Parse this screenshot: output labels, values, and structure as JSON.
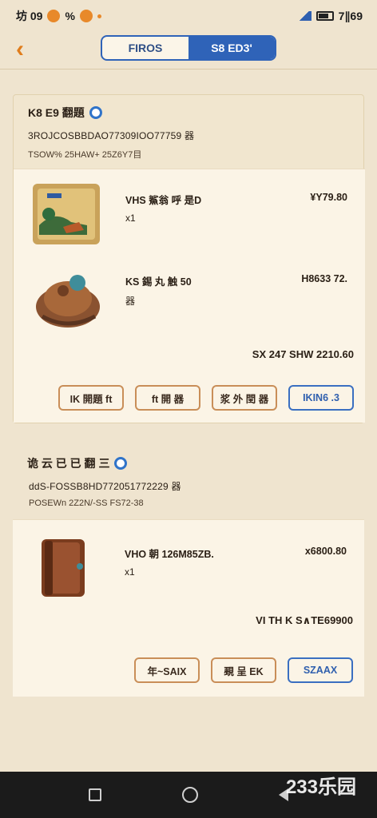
{
  "status_bar": {
    "time": "坊 09",
    "mid": "%",
    "right_text": "7∥69"
  },
  "header": {
    "tabs": [
      "FIROS",
      "S8 ED3'"
    ]
  },
  "orders": [
    {
      "shop_name": "K8 E9 翻題",
      "order_id": "3ROJCOSBBDAO77309IOO77759 器",
      "order_time": "TSOW% 25HAW+ 25Z6Y7目",
      "items": [
        {
          "title": "VHS 鯊翁 呼 是D",
          "qty": "x1",
          "price": "¥Y79.80"
        },
        {
          "title": "KS 錫 丸 触 50",
          "qty": "器",
          "price": "H8633 72."
        }
      ],
      "total": "SX 247 SHW 2210.60",
      "buttons": [
        "IK 開題 ft",
        "ft 開 器",
        "浆 外 閏 器",
        "IKIN6 .3"
      ]
    },
    {
      "shop_name": "诡 云 已 已 翻 三",
      "order_id": "ddS-FOSSB8HD772051772229 器",
      "order_time": "POSEWn 2Z2N/-SS FS72-38",
      "items": [
        {
          "title": "VHO 朝 126M85ZB.",
          "qty": "x1",
          "price": "x6800.80"
        }
      ],
      "total": "VI TH K S∧TE69900",
      "buttons": [
        "年~SAIX",
        "覡 呈 EK",
        "SZAAX"
      ]
    }
  ],
  "bottom_nav": {
    "watermark": "233乐园"
  },
  "colors": {
    "accent_orange": "#e07d1c",
    "primary_blue": "#2f63b8",
    "background": "#efe4cf"
  }
}
